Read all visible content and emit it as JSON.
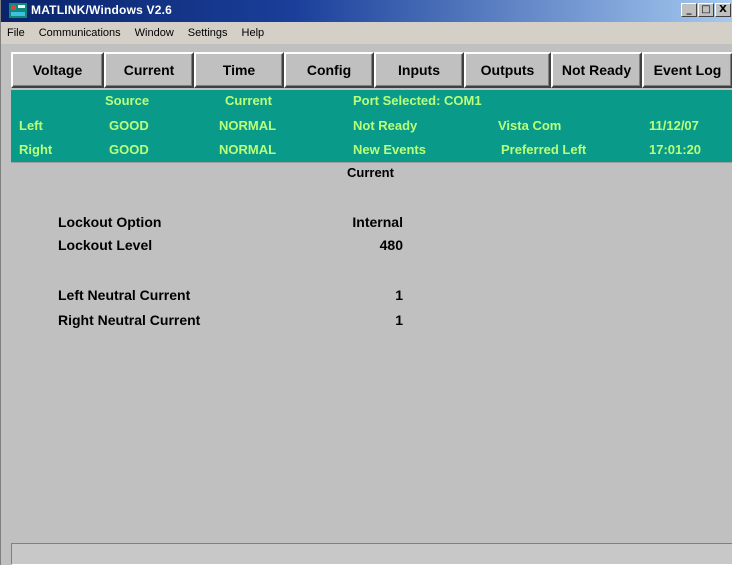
{
  "window": {
    "title": "MATLINK/Windows V2.6"
  },
  "window_controls": {
    "minimize": "_",
    "maximize": "□",
    "close": "X"
  },
  "menu": [
    "File",
    "Communications",
    "Window",
    "Settings",
    "Help"
  ],
  "tabs": [
    "Voltage",
    "Current",
    "Time",
    "Config",
    "Inputs",
    "Outputs",
    "Not Ready",
    "Event Log"
  ],
  "status_panel": {
    "header_source": "Source",
    "header_current": "Current",
    "port_selected": "Port Selected: COM1",
    "left_label": "Left",
    "left_source": "GOOD",
    "left_current": "NORMAL",
    "left_status": "Not Ready",
    "left_device": "Vista Com",
    "date": "11/12/07",
    "right_label": "Right",
    "right_source": "GOOD",
    "right_current": "NORMAL",
    "right_status": "New Events",
    "right_device": "Preferred Left",
    "time": "17:01:20",
    "text_color": "#b8ff7a",
    "bg_color": "#0a9a8a"
  },
  "content": {
    "title": "Current",
    "rows": [
      {
        "label": "Lockout Option",
        "value": "Internal"
      },
      {
        "label": "Lockout Level",
        "value": "480"
      },
      {
        "label": "Left Neutral Current",
        "value": "1"
      },
      {
        "label": "Right Neutral Current",
        "value": "1"
      }
    ]
  },
  "icons": {
    "app": "matlink-app-icon"
  }
}
